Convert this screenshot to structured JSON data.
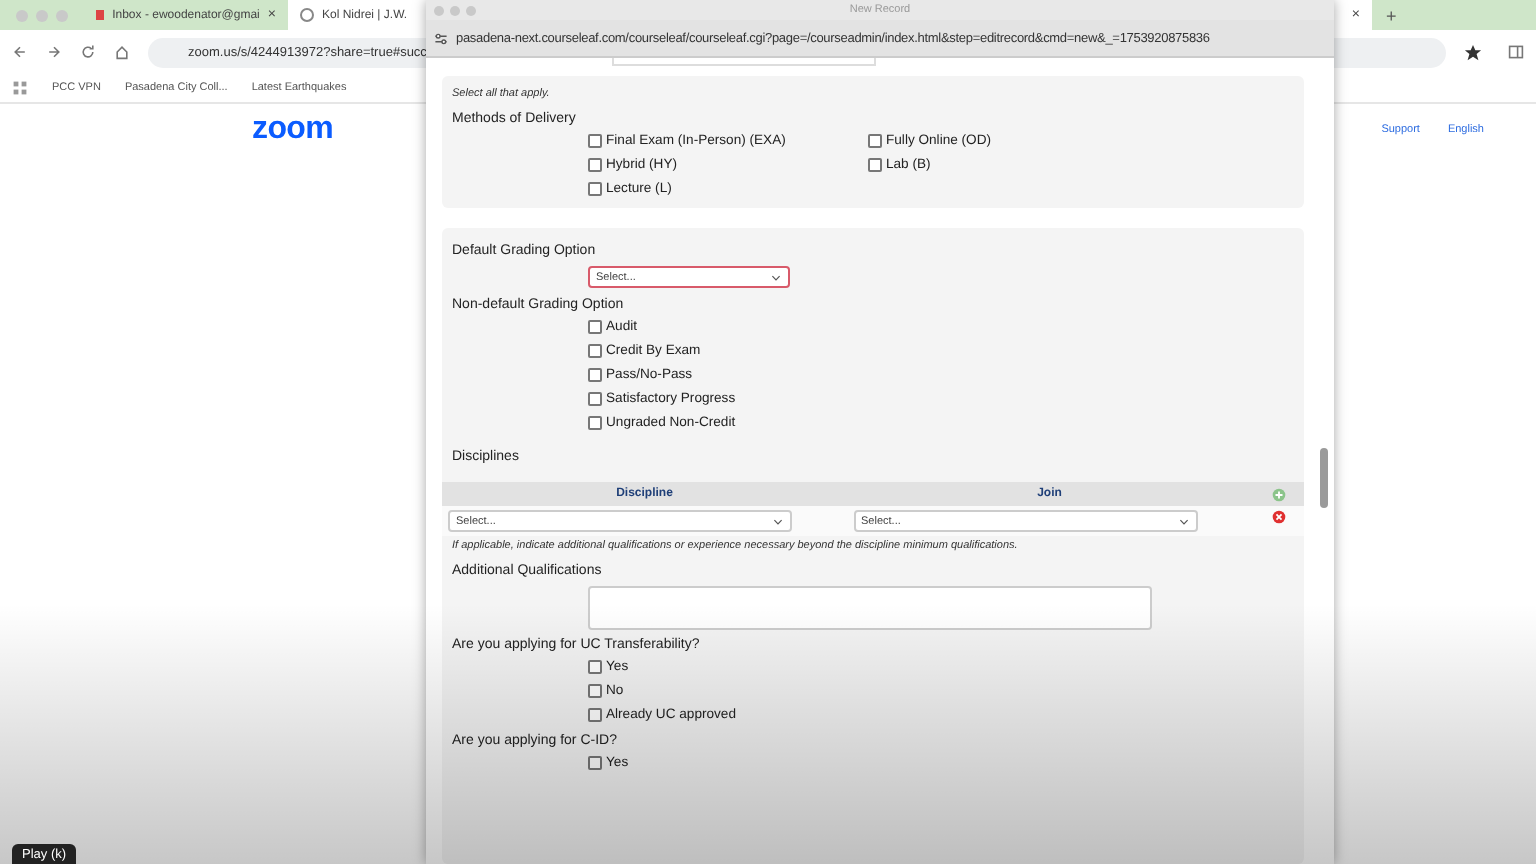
{
  "browser": {
    "tabs": [
      {
        "title": "Inbox - ewoodenator@gmai",
        "selected": false,
        "close": "×"
      },
      {
        "title": "Kol Nidrei | J.W.",
        "selected": true,
        "close": "×"
      }
    ],
    "new_tab": "+",
    "address": "zoom.us/s/4244913972?share=true#succ",
    "bookmarks": [
      "PCC VPN",
      "Pasadena City Coll...",
      "Latest Earthquakes"
    ],
    "page": {
      "logo": "zoom",
      "nav": [
        "Support",
        "English"
      ]
    }
  },
  "popup": {
    "title": "New Record",
    "url": "pasadena-next.courseleaf.com/courseleaf/courseleaf.cgi?page=/courseadmin/index.html&step=editrecord&cmd=new&_=1753920875836",
    "delivery": {
      "hint": "Select all that apply.",
      "label": "Methods of Delivery",
      "options": [
        {
          "label": "Final Exam (In-Person) (EXA)",
          "checked": false
        },
        {
          "label": "Fully Online (OD)",
          "checked": false
        },
        {
          "label": "Hybrid (HY)",
          "checked": false
        },
        {
          "label": "Lab (B)",
          "checked": false
        },
        {
          "label": "Lecture (L)",
          "checked": false
        }
      ]
    },
    "grading": {
      "default_label": "Default Grading Option",
      "default_select": "Select...",
      "nondefault_label": "Non-default Grading Option",
      "options": [
        {
          "label": "Audit",
          "checked": false
        },
        {
          "label": "Credit By Exam",
          "checked": false
        },
        {
          "label": "Pass/No-Pass",
          "checked": false
        },
        {
          "label": "Satisfactory Progress",
          "checked": false
        },
        {
          "label": "Ungraded Non-Credit",
          "checked": false
        }
      ]
    },
    "disciplines": {
      "label": "Disciplines",
      "columns": [
        "Discipline",
        "Join"
      ],
      "rows": [
        {
          "discipline": "Select...",
          "join": "Select..."
        }
      ]
    },
    "qualifications": {
      "hint": "If applicable, indicate additional qualifications or experience necessary beyond the discipline minimum qualifications.",
      "label": "Additional Qualifications"
    },
    "uc": {
      "question": "Are you applying for UC Transferability?",
      "options": [
        {
          "label": "Yes",
          "checked": false
        },
        {
          "label": "No",
          "checked": false
        },
        {
          "label": "Already UC approved",
          "checked": false
        }
      ]
    },
    "cid": {
      "question": "Are you applying for C-ID?",
      "options": [
        {
          "label": "Yes",
          "checked": false
        }
      ]
    }
  },
  "player": {
    "tooltip": "Play (k)"
  }
}
